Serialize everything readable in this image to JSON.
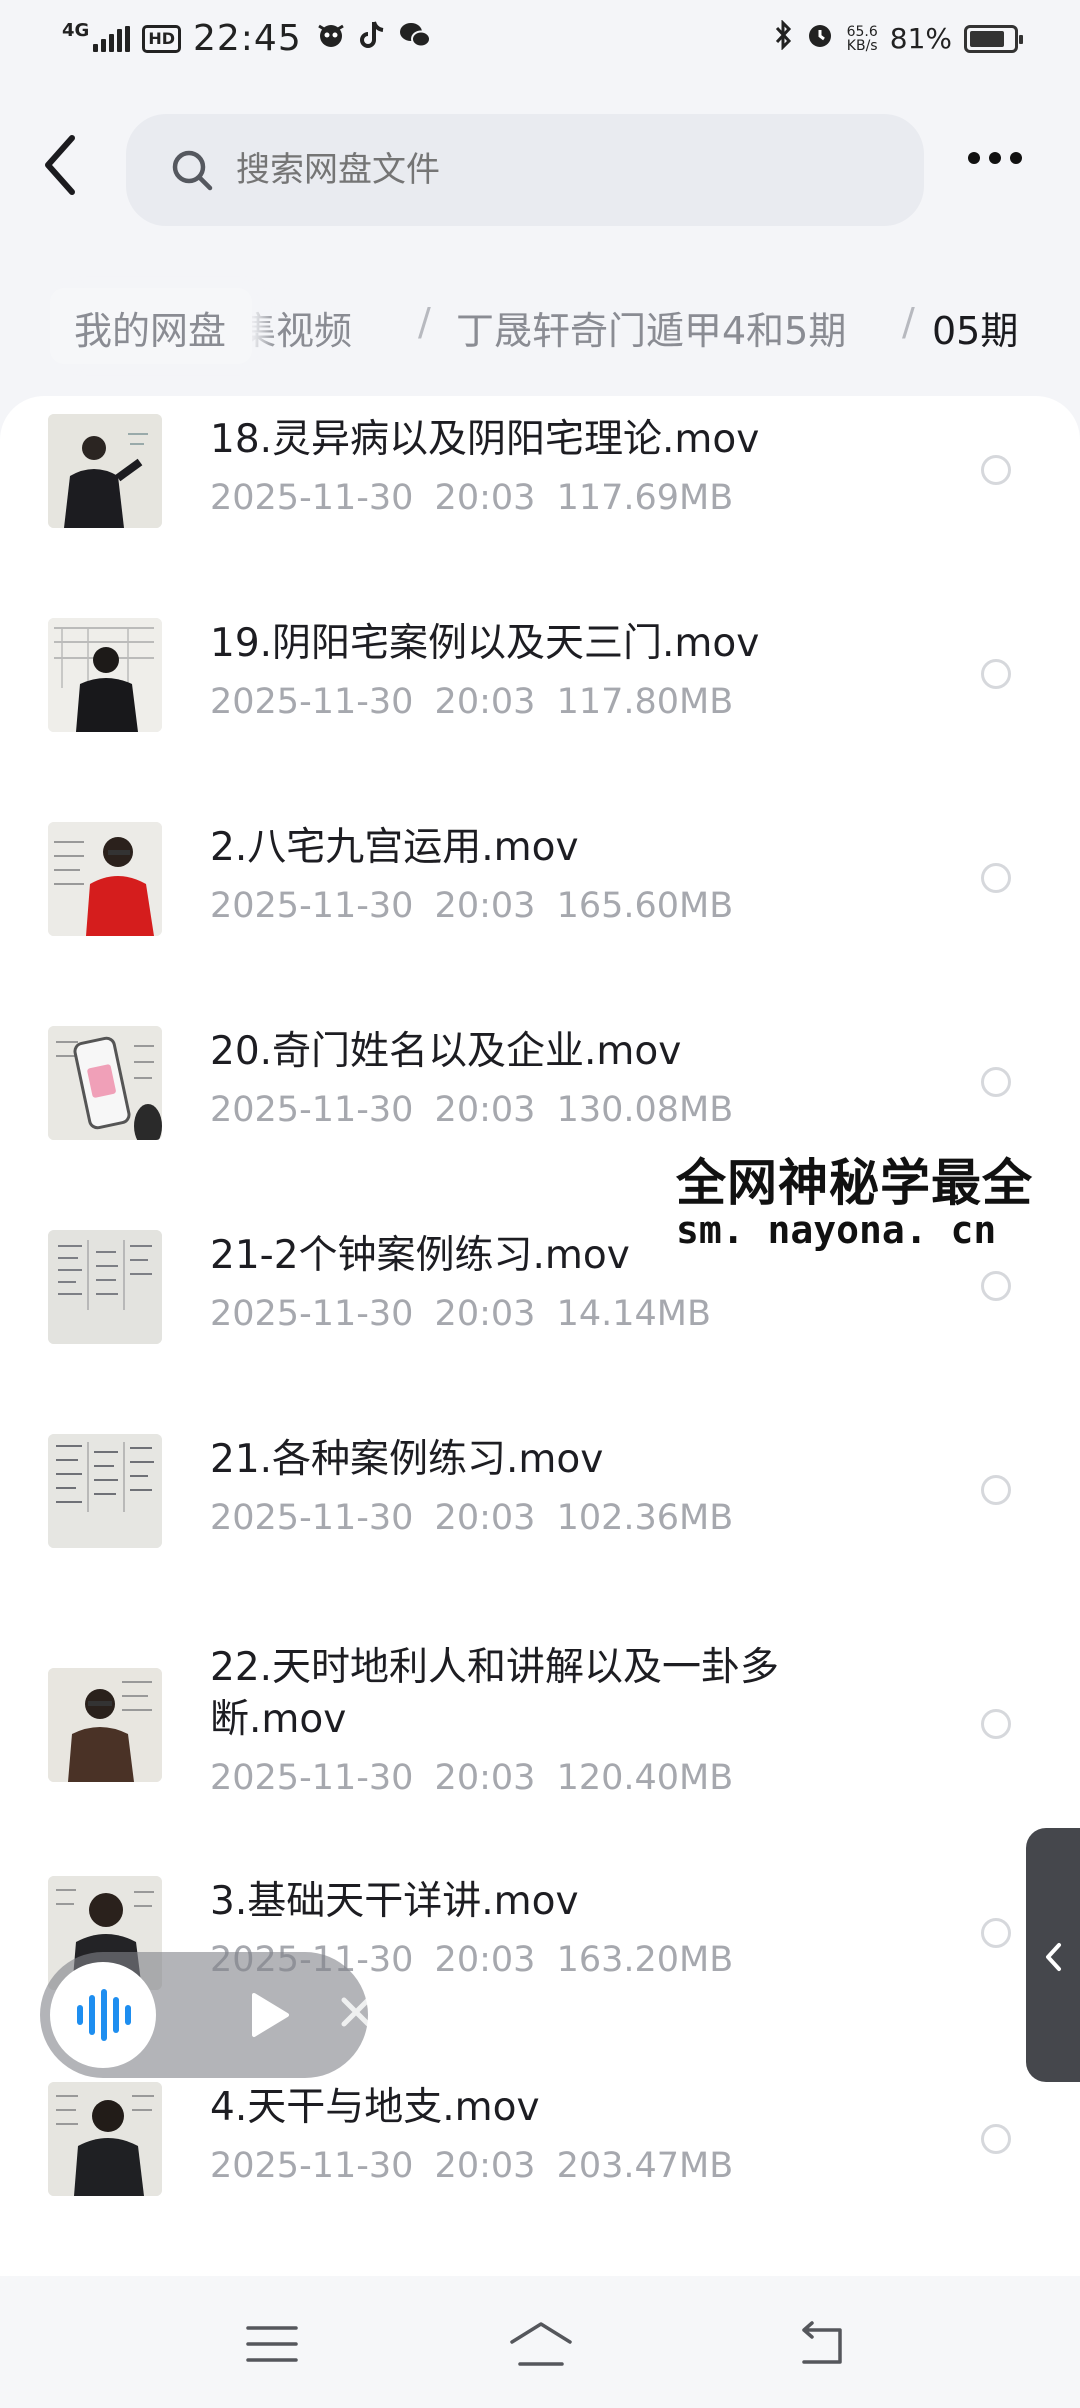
{
  "status_bar": {
    "network": "4G",
    "hd": "HD",
    "time": "22:45",
    "speed_value": "65.6",
    "speed_unit": "KB/s",
    "battery_text": "81%",
    "battery_level": 0.81
  },
  "search": {
    "placeholder": "搜索网盘文件"
  },
  "breadcrumb": {
    "home": "我的网盘",
    "hidden_fragment": "集视频",
    "separator": "/",
    "folder": "丁晟轩奇门遁甲4和5期",
    "current": "05期"
  },
  "files": [
    {
      "name": "18.灵异病以及阴阳宅理论.mov",
      "date": "2025-11-30",
      "time": "20:03",
      "size": "117.69MB",
      "thumb": "teacher-dark"
    },
    {
      "name": "19.阴阳宅案例以及天三门.mov",
      "date": "2025-11-30",
      "time": "20:03",
      "size": "117.80MB",
      "thumb": "teacher-back"
    },
    {
      "name": "2.八宅九宫运用.mov",
      "date": "2025-11-30",
      "time": "20:03",
      "size": "165.60MB",
      "thumb": "teacher-red"
    },
    {
      "name": "20.奇门姓名以及企业.mov",
      "date": "2025-11-30",
      "time": "20:03",
      "size": "130.08MB",
      "thumb": "phone"
    },
    {
      "name": "21-2个钟案例练习.mov",
      "date": "2025-11-30",
      "time": "20:03",
      "size": "14.14MB",
      "thumb": "board"
    },
    {
      "name": "21.各种案例练习.mov",
      "date": "2025-11-30",
      "time": "20:03",
      "size": "102.36MB",
      "thumb": "board"
    },
    {
      "name": "22.天时地利人和讲解以及一卦多断.mov",
      "date": "2025-11-30",
      "time": "20:03",
      "size": "120.40MB",
      "thumb": "teacher-brown"
    },
    {
      "name": "3.基础天干详讲.mov",
      "date": "2025-11-30",
      "time": "20:03",
      "size": "163.20MB",
      "thumb": "teacher-smile"
    },
    {
      "name": "4.天干与地支.mov",
      "date": "2025-11-30",
      "time": "20:03",
      "size": "203.47MB",
      "thumb": "teacher-black"
    }
  ],
  "watermark": {
    "line1": "全网神秘学最全",
    "line2": "sm. nayona. cn"
  },
  "icons": {
    "back": "chevron-left-icon",
    "search": "search-icon",
    "more": "more-horizontal-icon",
    "player_wave": "audio-wave-icon",
    "player_play": "play-icon",
    "player_close": "close-icon",
    "side_tab": "chevron-left-icon",
    "nav_menu": "menu-icon",
    "nav_home": "home-icon",
    "nav_back": "return-icon"
  },
  "colors": {
    "background": "#f4f5f8",
    "list_bg": "#ffffff",
    "text_primary": "#1d1d22",
    "text_secondary": "#a6a8ae",
    "player_wave": "#1e8ef0"
  }
}
